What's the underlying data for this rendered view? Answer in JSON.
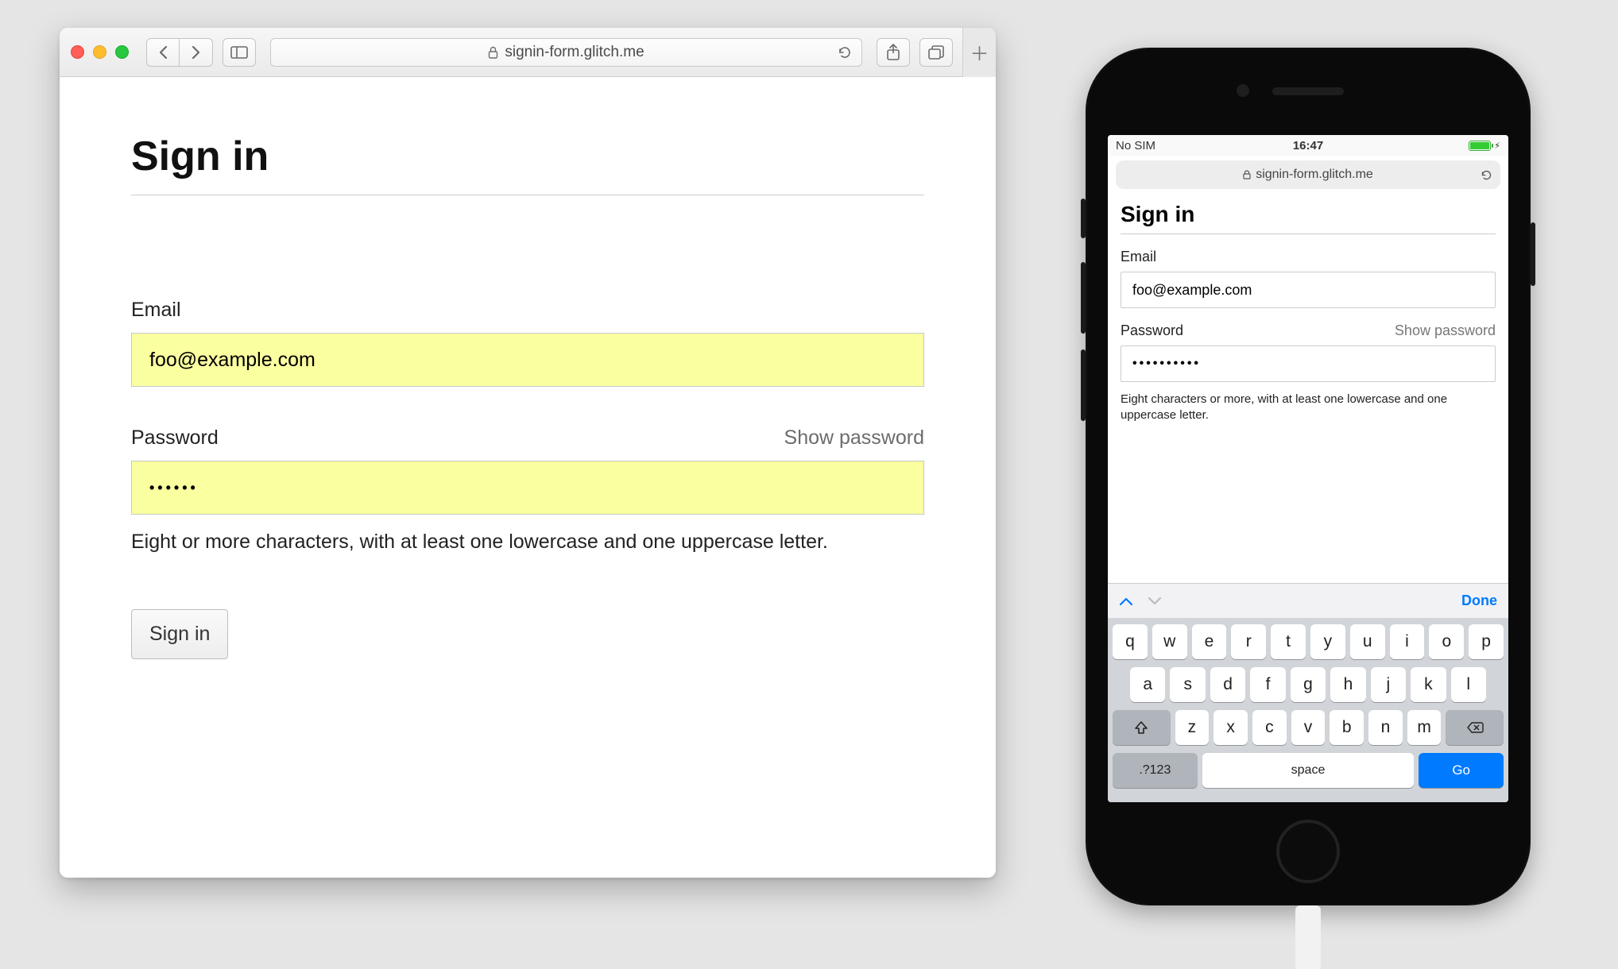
{
  "desktop": {
    "url": "signin-form.glitch.me",
    "page": {
      "title": "Sign in",
      "email_label": "Email",
      "email_value": "foo@example.com",
      "password_label": "Password",
      "show_password": "Show password",
      "password_value": "••••••",
      "hint": "Eight or more characters, with at least one lowercase and one uppercase letter.",
      "submit": "Sign in"
    }
  },
  "mobile": {
    "status": {
      "carrier": "No SIM",
      "time": "16:47"
    },
    "url": "signin-form.glitch.me",
    "page": {
      "title": "Sign in",
      "email_label": "Email",
      "email_value": "foo@example.com",
      "password_label": "Password",
      "show_password": "Show password",
      "password_value": "••••••••••",
      "hint": "Eight characters or more, with at least one lowercase and one uppercase letter."
    },
    "kb_accessory": {
      "done": "Done"
    },
    "keyboard": {
      "row1": [
        "q",
        "w",
        "e",
        "r",
        "t",
        "y",
        "u",
        "i",
        "o",
        "p"
      ],
      "row2": [
        "a",
        "s",
        "d",
        "f",
        "g",
        "h",
        "j",
        "k",
        "l"
      ],
      "row3": [
        "z",
        "x",
        "c",
        "v",
        "b",
        "n",
        "m"
      ],
      "num_key": ".?123",
      "space": "space",
      "go": "Go"
    }
  }
}
